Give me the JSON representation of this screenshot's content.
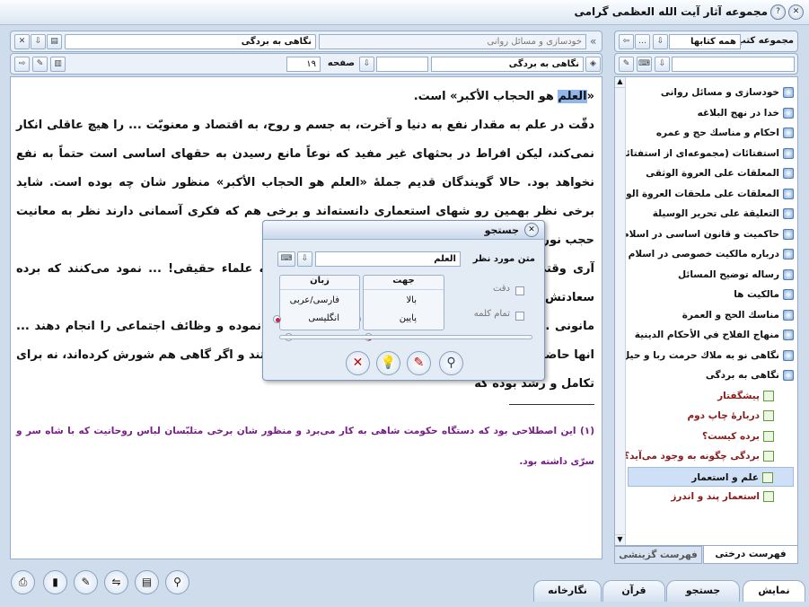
{
  "window": {
    "title": "مجموعه آثار آیت الله العظمی گرامی"
  },
  "reader": {
    "tab_active": "نگاهی به بردگی",
    "tab_inactive": "خودسازی و مسائل روانی",
    "book_field": "نگاهی به بردگی",
    "page_label": "صفحه",
    "page_value": "۱۹",
    "text_highlight": "العلم",
    "text_line1_rest": " هو الحجاب الأكبر» است.",
    "text_body": "دقّت در علم به مقدار نفع به دنیا و آخرت، به جسم و روح، به اقتصاد و معنویّت ... را هیچ عاقلی انکار نمی‌کند، لیکن افراط در بحثهای غیر مفید که نوعاً مانع رسیدن به حقهای اساسی است حتماً به نفع نخواهد بود. حالا گویندگان قدیم جملهٔ «العلم هو الحجاب الأکبر» منظور شان چه بوده است. شاید برخی نظر بهمین رو شهای استعماری دانسته‌اند و برخی هم که فکری آسمانی دارند نظر به معانیت حجب نوری و از جمله علم، نسبت به معنویت",
    "text_p2": "آری وقتی ... و دانشمندان و علماء باید اقدام کنند البته علماء حقیقی! ... نمود می‌کنند که برده سعادتش این است که زیر بار با شد",
    "text_p3": "ما‌نونی ... ر روانی نمی‌توانند تحمّل بار سنگین مسئولیّت نموده و وظائف اجتماعی را انجام دهند ... انها حاضر به ترک پدر و مادر خویش و ترقیّات مستقلّ نیستند و اگر گاهی هم شورش کرده‌اند، نه برای تکامل و رشد بوده که",
    "footnote": "(۱) این اصطلاحی بود که دستگاه حکومت شاهی به کار می‌برد و منظور شان برخی متلبّسان لباس روحانیت که با شاه سر و سرّی داشته بود."
  },
  "sidebar": {
    "header_label": "مجموعه کتب",
    "filter_value": "همه کتابها",
    "tree_items": [
      "خودسازی و مسائل روانی",
      "خدا در نهج البلاغه",
      "احکام و مناسك حج و عمره",
      "استفتائات (مجموعه‌ای از استفتائات)",
      "المعلقات على العروة الوثقى",
      "المعلقات على ملحقات العروة الوثقى",
      "التعليقة على تحرير الوسيلة",
      "حاكمیت و قانون اساسی در اسلام",
      "درباره مالکیت خصوصی در اسلام",
      "رساله توضیح المسائل",
      "مالکیت ها",
      "مناسك الحج و العمرة",
      "منهاج الفلاح في الأحكام الدينية",
      "نگاهی نو به ملاك حرمت ربا و حیل",
      "نگاهی به بردگی"
    ],
    "child_items": [
      "پیشگفتار",
      "دربارهٔ چاپ دوم",
      "برده کیست؟",
      "بردگی چگونه به وجود می‌آید؟",
      "علم و استعمار",
      "استعمار پند و اندرز"
    ],
    "tab_tree": "فهرست درختی",
    "tab_selective": "فهرست گزینشی"
  },
  "search_dialog": {
    "title": "جستجو",
    "text_label": "متن مورد نظر",
    "text_value": "العلم",
    "exact_label": "دقت",
    "whole_word_label": "تمام کلمه",
    "direction_label": "جهت",
    "dir_up": "بالا",
    "dir_down": "پایین",
    "language_label": "زبان",
    "lang_fa": "فارسی/عربی",
    "lang_en": "انگلیسی"
  },
  "bottom_tabs": {
    "show": "نمایش",
    "search": "جستجو",
    "quran": "قرآن",
    "gallery": "نگارخانه"
  },
  "colors": {
    "highlight": "#8fb7ee",
    "footnote": "#7a1a8a",
    "child_item": "#8a1a1a"
  }
}
